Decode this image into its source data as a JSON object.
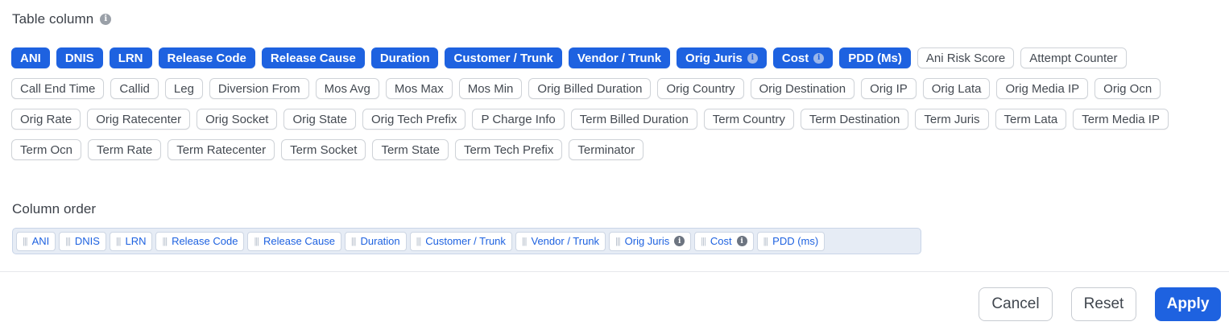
{
  "table_column": {
    "title": "Table column",
    "columns": [
      {
        "label": "ANI",
        "selected": true,
        "info": false
      },
      {
        "label": "DNIS",
        "selected": true,
        "info": false
      },
      {
        "label": "LRN",
        "selected": true,
        "info": false
      },
      {
        "label": "Release Code",
        "selected": true,
        "info": false
      },
      {
        "label": "Release Cause",
        "selected": true,
        "info": false
      },
      {
        "label": "Duration",
        "selected": true,
        "info": false
      },
      {
        "label": "Customer / Trunk",
        "selected": true,
        "info": false
      },
      {
        "label": "Vendor / Trunk",
        "selected": true,
        "info": false
      },
      {
        "label": "Orig Juris",
        "selected": true,
        "info": true
      },
      {
        "label": "Cost",
        "selected": true,
        "info": true
      },
      {
        "label": "PDD (Ms)",
        "selected": true,
        "info": false
      },
      {
        "label": "Ani Risk Score",
        "selected": false,
        "info": false
      },
      {
        "label": "Attempt Counter",
        "selected": false,
        "info": false
      },
      {
        "label": "Call End Time",
        "selected": false,
        "info": false
      },
      {
        "label": "Callid",
        "selected": false,
        "info": false
      },
      {
        "label": "Leg",
        "selected": false,
        "info": false
      },
      {
        "label": "Diversion From",
        "selected": false,
        "info": false
      },
      {
        "label": "Mos Avg",
        "selected": false,
        "info": false
      },
      {
        "label": "Mos Max",
        "selected": false,
        "info": false
      },
      {
        "label": "Mos Min",
        "selected": false,
        "info": false
      },
      {
        "label": "Orig Billed Duration",
        "selected": false,
        "info": false
      },
      {
        "label": "Orig Country",
        "selected": false,
        "info": false
      },
      {
        "label": "Orig Destination",
        "selected": false,
        "info": false
      },
      {
        "label": "Orig IP",
        "selected": false,
        "info": false
      },
      {
        "label": "Orig Lata",
        "selected": false,
        "info": false
      },
      {
        "label": "Orig Media IP",
        "selected": false,
        "info": false
      },
      {
        "label": "Orig Ocn",
        "selected": false,
        "info": false
      },
      {
        "label": "Orig Rate",
        "selected": false,
        "info": false
      },
      {
        "label": "Orig Ratecenter",
        "selected": false,
        "info": false
      },
      {
        "label": "Orig Socket",
        "selected": false,
        "info": false
      },
      {
        "label": "Orig State",
        "selected": false,
        "info": false
      },
      {
        "label": "Orig Tech Prefix",
        "selected": false,
        "info": false
      },
      {
        "label": "P Charge Info",
        "selected": false,
        "info": false
      },
      {
        "label": "Term Billed Duration",
        "selected": false,
        "info": false
      },
      {
        "label": "Term Country",
        "selected": false,
        "info": false
      },
      {
        "label": "Term Destination",
        "selected": false,
        "info": false
      },
      {
        "label": "Term Juris",
        "selected": false,
        "info": false
      },
      {
        "label": "Term Lata",
        "selected": false,
        "info": false
      },
      {
        "label": "Term Media IP",
        "selected": false,
        "info": false
      },
      {
        "label": "Term Ocn",
        "selected": false,
        "info": false
      },
      {
        "label": "Term Rate",
        "selected": false,
        "info": false
      },
      {
        "label": "Term Ratecenter",
        "selected": false,
        "info": false
      },
      {
        "label": "Term Socket",
        "selected": false,
        "info": false
      },
      {
        "label": "Term State",
        "selected": false,
        "info": false
      },
      {
        "label": "Term Tech Prefix",
        "selected": false,
        "info": false
      },
      {
        "label": "Terminator",
        "selected": false,
        "info": false
      }
    ]
  },
  "column_order": {
    "title": "Column order",
    "items": [
      {
        "label": "ANI",
        "info": false
      },
      {
        "label": "DNIS",
        "info": false
      },
      {
        "label": "LRN",
        "info": false
      },
      {
        "label": "Release Code",
        "info": false
      },
      {
        "label": "Release Cause",
        "info": false
      },
      {
        "label": "Duration",
        "info": false
      },
      {
        "label": "Customer / Trunk",
        "info": false
      },
      {
        "label": "Vendor / Trunk",
        "info": false
      },
      {
        "label": "Orig Juris",
        "info": true
      },
      {
        "label": "Cost",
        "info": true
      },
      {
        "label": "PDD (ms)",
        "info": false
      }
    ]
  },
  "actions": {
    "cancel": "Cancel",
    "reset": "Reset",
    "apply": "Apply"
  },
  "icons": {
    "info_glyph": "i",
    "grip_glyph": "|||"
  },
  "colors": {
    "accent": "#1e62e0"
  }
}
